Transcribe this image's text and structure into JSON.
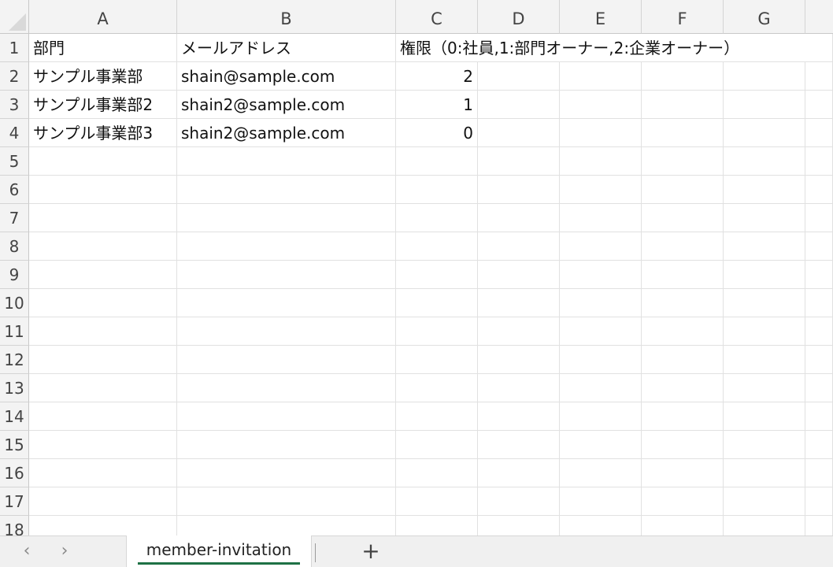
{
  "spreadsheet": {
    "columns": [
      "A",
      "B",
      "C",
      "D",
      "E",
      "F",
      "G"
    ],
    "rows": [
      "1",
      "2",
      "3",
      "4",
      "5",
      "6",
      "7",
      "8",
      "9",
      "10",
      "11",
      "12",
      "13",
      "14",
      "15",
      "16",
      "17",
      "18"
    ],
    "cells": {
      "A1": "部門",
      "B1": "メールアドレス",
      "C1": "権限（0:社員,1:部門オーナー,2:企業オーナー）",
      "A2": "サンプル事業部",
      "B2": "shain@sample.com",
      "C2": "2",
      "A3": "サンプル事業部2",
      "B3": "shain2@sample.com",
      "C3": "1",
      "A4": "サンプル事業部3",
      "B4": "shain2@sample.com",
      "C4": "0"
    }
  },
  "sheetbar": {
    "prev_icon": "‹",
    "next_icon": "›",
    "active_sheet": "member-invitation",
    "add_icon": "+"
  },
  "colors": {
    "active_tab_underline": "#1e7145"
  }
}
